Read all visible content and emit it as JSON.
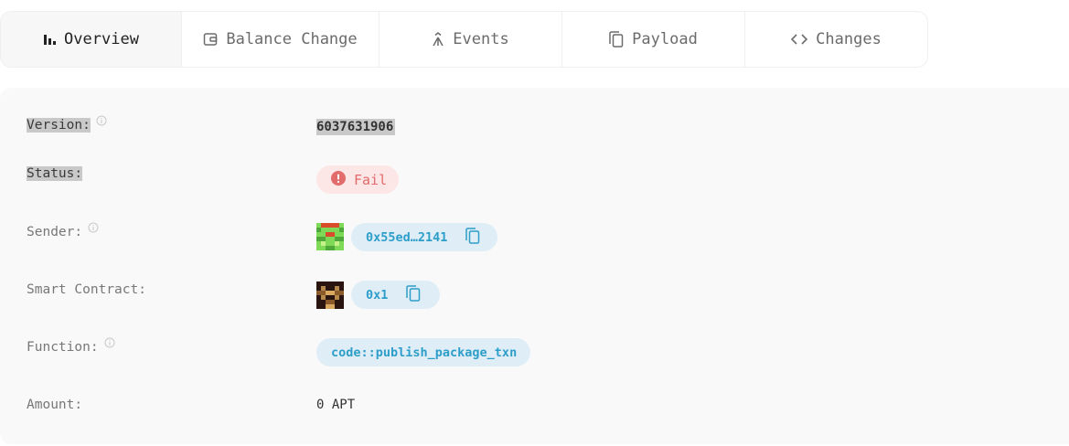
{
  "tabs": [
    {
      "label": "Overview",
      "icon": "bar-chart-icon",
      "active": true
    },
    {
      "label": "Balance Change",
      "icon": "wallet-icon"
    },
    {
      "label": "Events",
      "icon": "merge-arrow-icon"
    },
    {
      "label": "Payload",
      "icon": "copy-icon"
    },
    {
      "label": "Changes",
      "icon": "code-icon"
    }
  ],
  "details": {
    "version_label": "Version:",
    "version_value": "6037631906",
    "status_label": "Status:",
    "status_value": "Fail",
    "sender_label": "Sender:",
    "sender_value": "0x55ed…2141",
    "contract_label": "Smart Contract:",
    "contract_value": "0x1",
    "function_label": "Function:",
    "function_value": "code::publish_package_txn",
    "amount_label": "Amount:",
    "amount_value": "0 APT"
  },
  "colors": {
    "fail_bg": "#fde6e6",
    "fail_text": "#e26b6b",
    "address_bg": "#dfeef6",
    "address_text": "#2d9ec9"
  }
}
